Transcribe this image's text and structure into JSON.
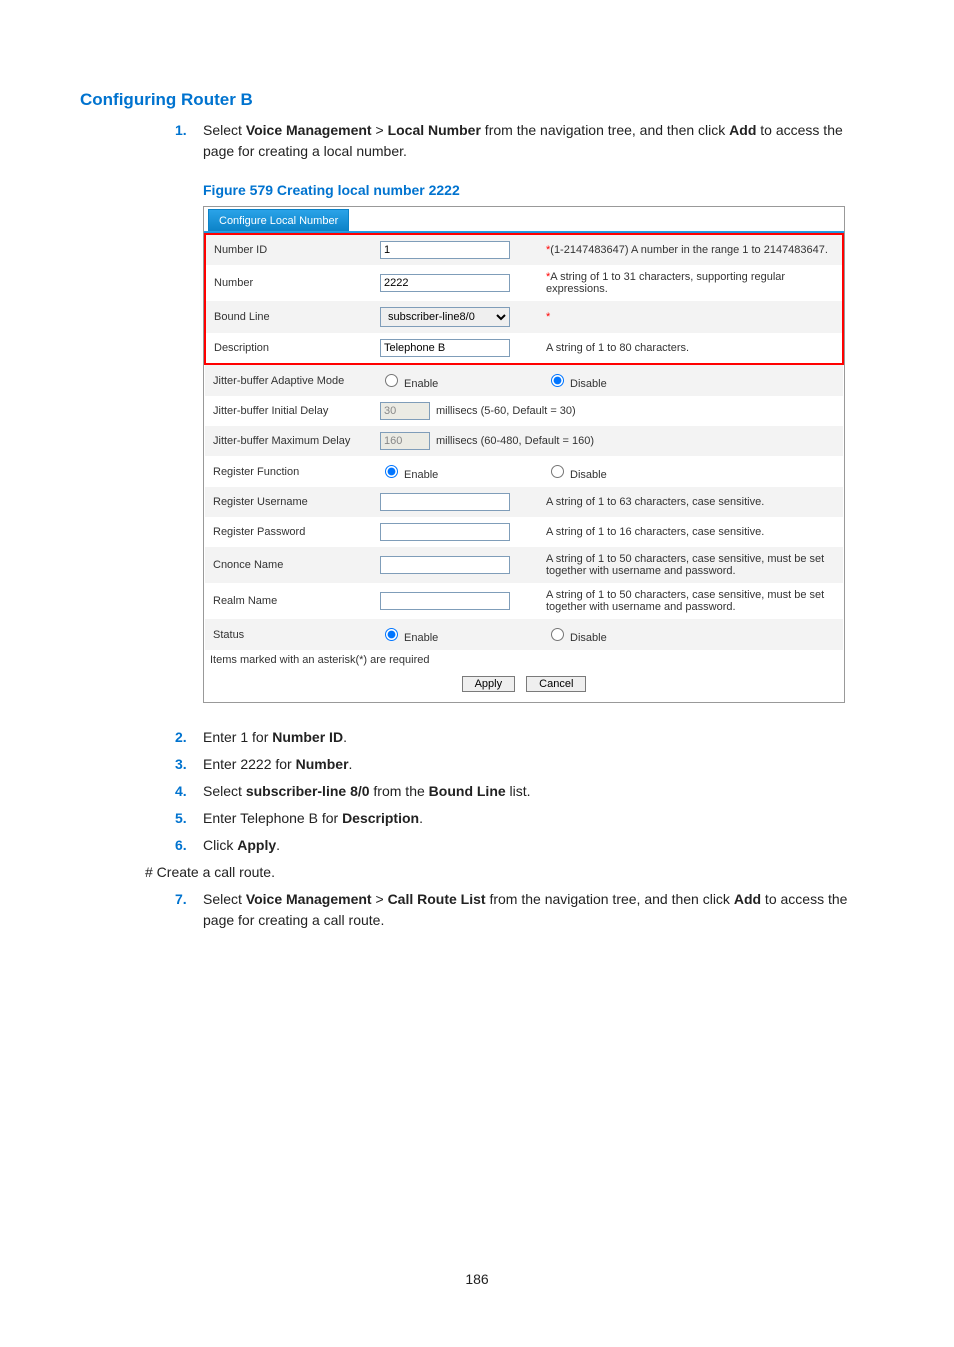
{
  "heading": "Configuring Router B",
  "step1": {
    "num": "1.",
    "prefix": "Select ",
    "vm": "Voice Management",
    "gt": " > ",
    "ln": "Local Number",
    "mid": " from the navigation tree, and then click ",
    "add": "Add",
    "suffix": " to access the page for creating a local number."
  },
  "figure_caption": "Figure 579 Creating local number 2222",
  "screenshot": {
    "tab": "Configure Local Number",
    "rows": {
      "number_id": {
        "label": "Number ID",
        "value": "1",
        "hint_prefix": "*",
        "hint": "(1-2147483647) A number in the range 1 to 2147483647."
      },
      "number": {
        "label": "Number",
        "value": "2222",
        "hint_prefix": "*",
        "hint": "A string of 1 to 31 characters, supporting regular expressions."
      },
      "bound_line": {
        "label": "Bound Line",
        "value": "subscriber-line8/0",
        "hint_prefix": "*",
        "hint": ""
      },
      "description": {
        "label": "Description",
        "value": "Telephone B",
        "hint": "A string of 1 to 80 characters."
      },
      "jb_mode": {
        "label": "Jitter-buffer Adaptive Mode",
        "enable": "Enable",
        "disable": "Disable"
      },
      "jb_initial": {
        "label": "Jitter-buffer Initial Delay",
        "value": "30",
        "suffix": "millisecs (5-60, Default = 30)"
      },
      "jb_max": {
        "label": "Jitter-buffer Maximum Delay",
        "value": "160",
        "suffix": "millisecs (60-480, Default = 160)"
      },
      "reg_func": {
        "label": "Register Function",
        "enable": "Enable",
        "disable": "Disable"
      },
      "reg_user": {
        "label": "Register Username",
        "hint": "A string of 1 to 63 characters, case sensitive."
      },
      "reg_pass": {
        "label": "Register Password",
        "hint": "A string of 1 to 16 characters, case sensitive."
      },
      "cnonce": {
        "label": "Cnonce Name",
        "hint": "A string of 1 to 50 characters, case sensitive, must be set together with username and password."
      },
      "realm": {
        "label": "Realm Name",
        "hint": "A string of 1 to 50 characters, case sensitive, must be set together with username and password."
      },
      "status": {
        "label": "Status",
        "enable": "Enable",
        "disable": "Disable"
      }
    },
    "footer_note": "Items marked with an asterisk(*) are required",
    "apply": "Apply",
    "cancel": "Cancel"
  },
  "step2": {
    "num": "2.",
    "prefix": "Enter 1 for ",
    "b": "Number ID",
    "suffix": "."
  },
  "step3": {
    "num": "3.",
    "prefix": "Enter 2222 for ",
    "b": "Number",
    "suffix": "."
  },
  "step4": {
    "num": "4.",
    "prefix": "Select ",
    "b1": "subscriber-line 8/0",
    "mid": " from the ",
    "b2": "Bound Line",
    "suffix": " list."
  },
  "step5": {
    "num": "5.",
    "prefix": "Enter Telephone B for ",
    "b": "Description",
    "suffix": "."
  },
  "step6": {
    "num": "6.",
    "prefix": "Click ",
    "b": "Apply",
    "suffix": "."
  },
  "hash_note": "# Create a call route.",
  "step7": {
    "num": "7.",
    "prefix": "Select ",
    "vm": "Voice Management",
    "gt": " > ",
    "crl": "Call Route List",
    "mid": " from the navigation tree, and then click ",
    "add": "Add",
    "suffix": " to access the page for creating a call route."
  },
  "pagenum": "186"
}
